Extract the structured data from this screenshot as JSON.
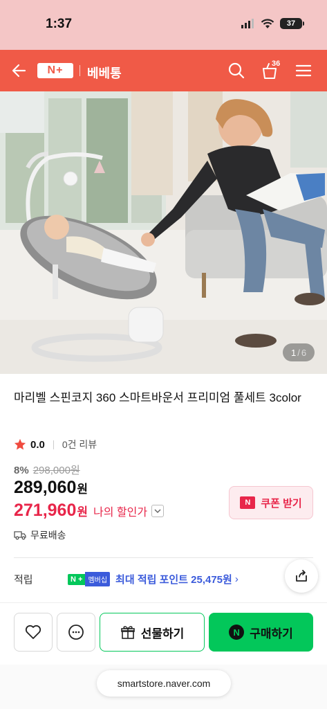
{
  "status_bar": {
    "time": "1:37",
    "battery": "37"
  },
  "header": {
    "brand": "N+",
    "store_name": "베베통",
    "cart_count": "36"
  },
  "product": {
    "image_counter": {
      "current": "1",
      "total": "6"
    },
    "title": "마리벨 스핀코지 360 스마트바운서 프리미엄 풀세트 3color",
    "rating": "0.0",
    "review_count": "0건 리뷰",
    "discount_rate": "8%",
    "original_price": "298,000원",
    "price": "289,060",
    "price_unit": "원",
    "my_price": "271,960",
    "my_price_unit": "원",
    "my_price_label": "나의 할인가",
    "coupon_button": "쿠폰 받기",
    "coupon_icon": "N",
    "shipping": "무료배송",
    "points_label": "적립",
    "membership_badge_n": "N +",
    "membership_badge_text": "멤버십",
    "points_text": "최대 적립 포인트 25,475원"
  },
  "bottom_bar": {
    "gift_label": "선물하기",
    "buy_label": "구매하기",
    "npay_icon": "N"
  },
  "browser": {
    "url": "smartstore.naver.com"
  },
  "colors": {
    "header": "#f05a47",
    "status_bar": "#f4c6c6",
    "accent_red": "#e8264a",
    "naver_green": "#03c75a",
    "points_blue": "#3b5bdb"
  },
  "icons": [
    "back-arrow-icon",
    "search-icon",
    "cart-icon",
    "menu-icon",
    "star-icon",
    "chevron-down-icon",
    "truck-icon",
    "share-icon",
    "heart-icon",
    "chat-icon",
    "gift-icon"
  ]
}
